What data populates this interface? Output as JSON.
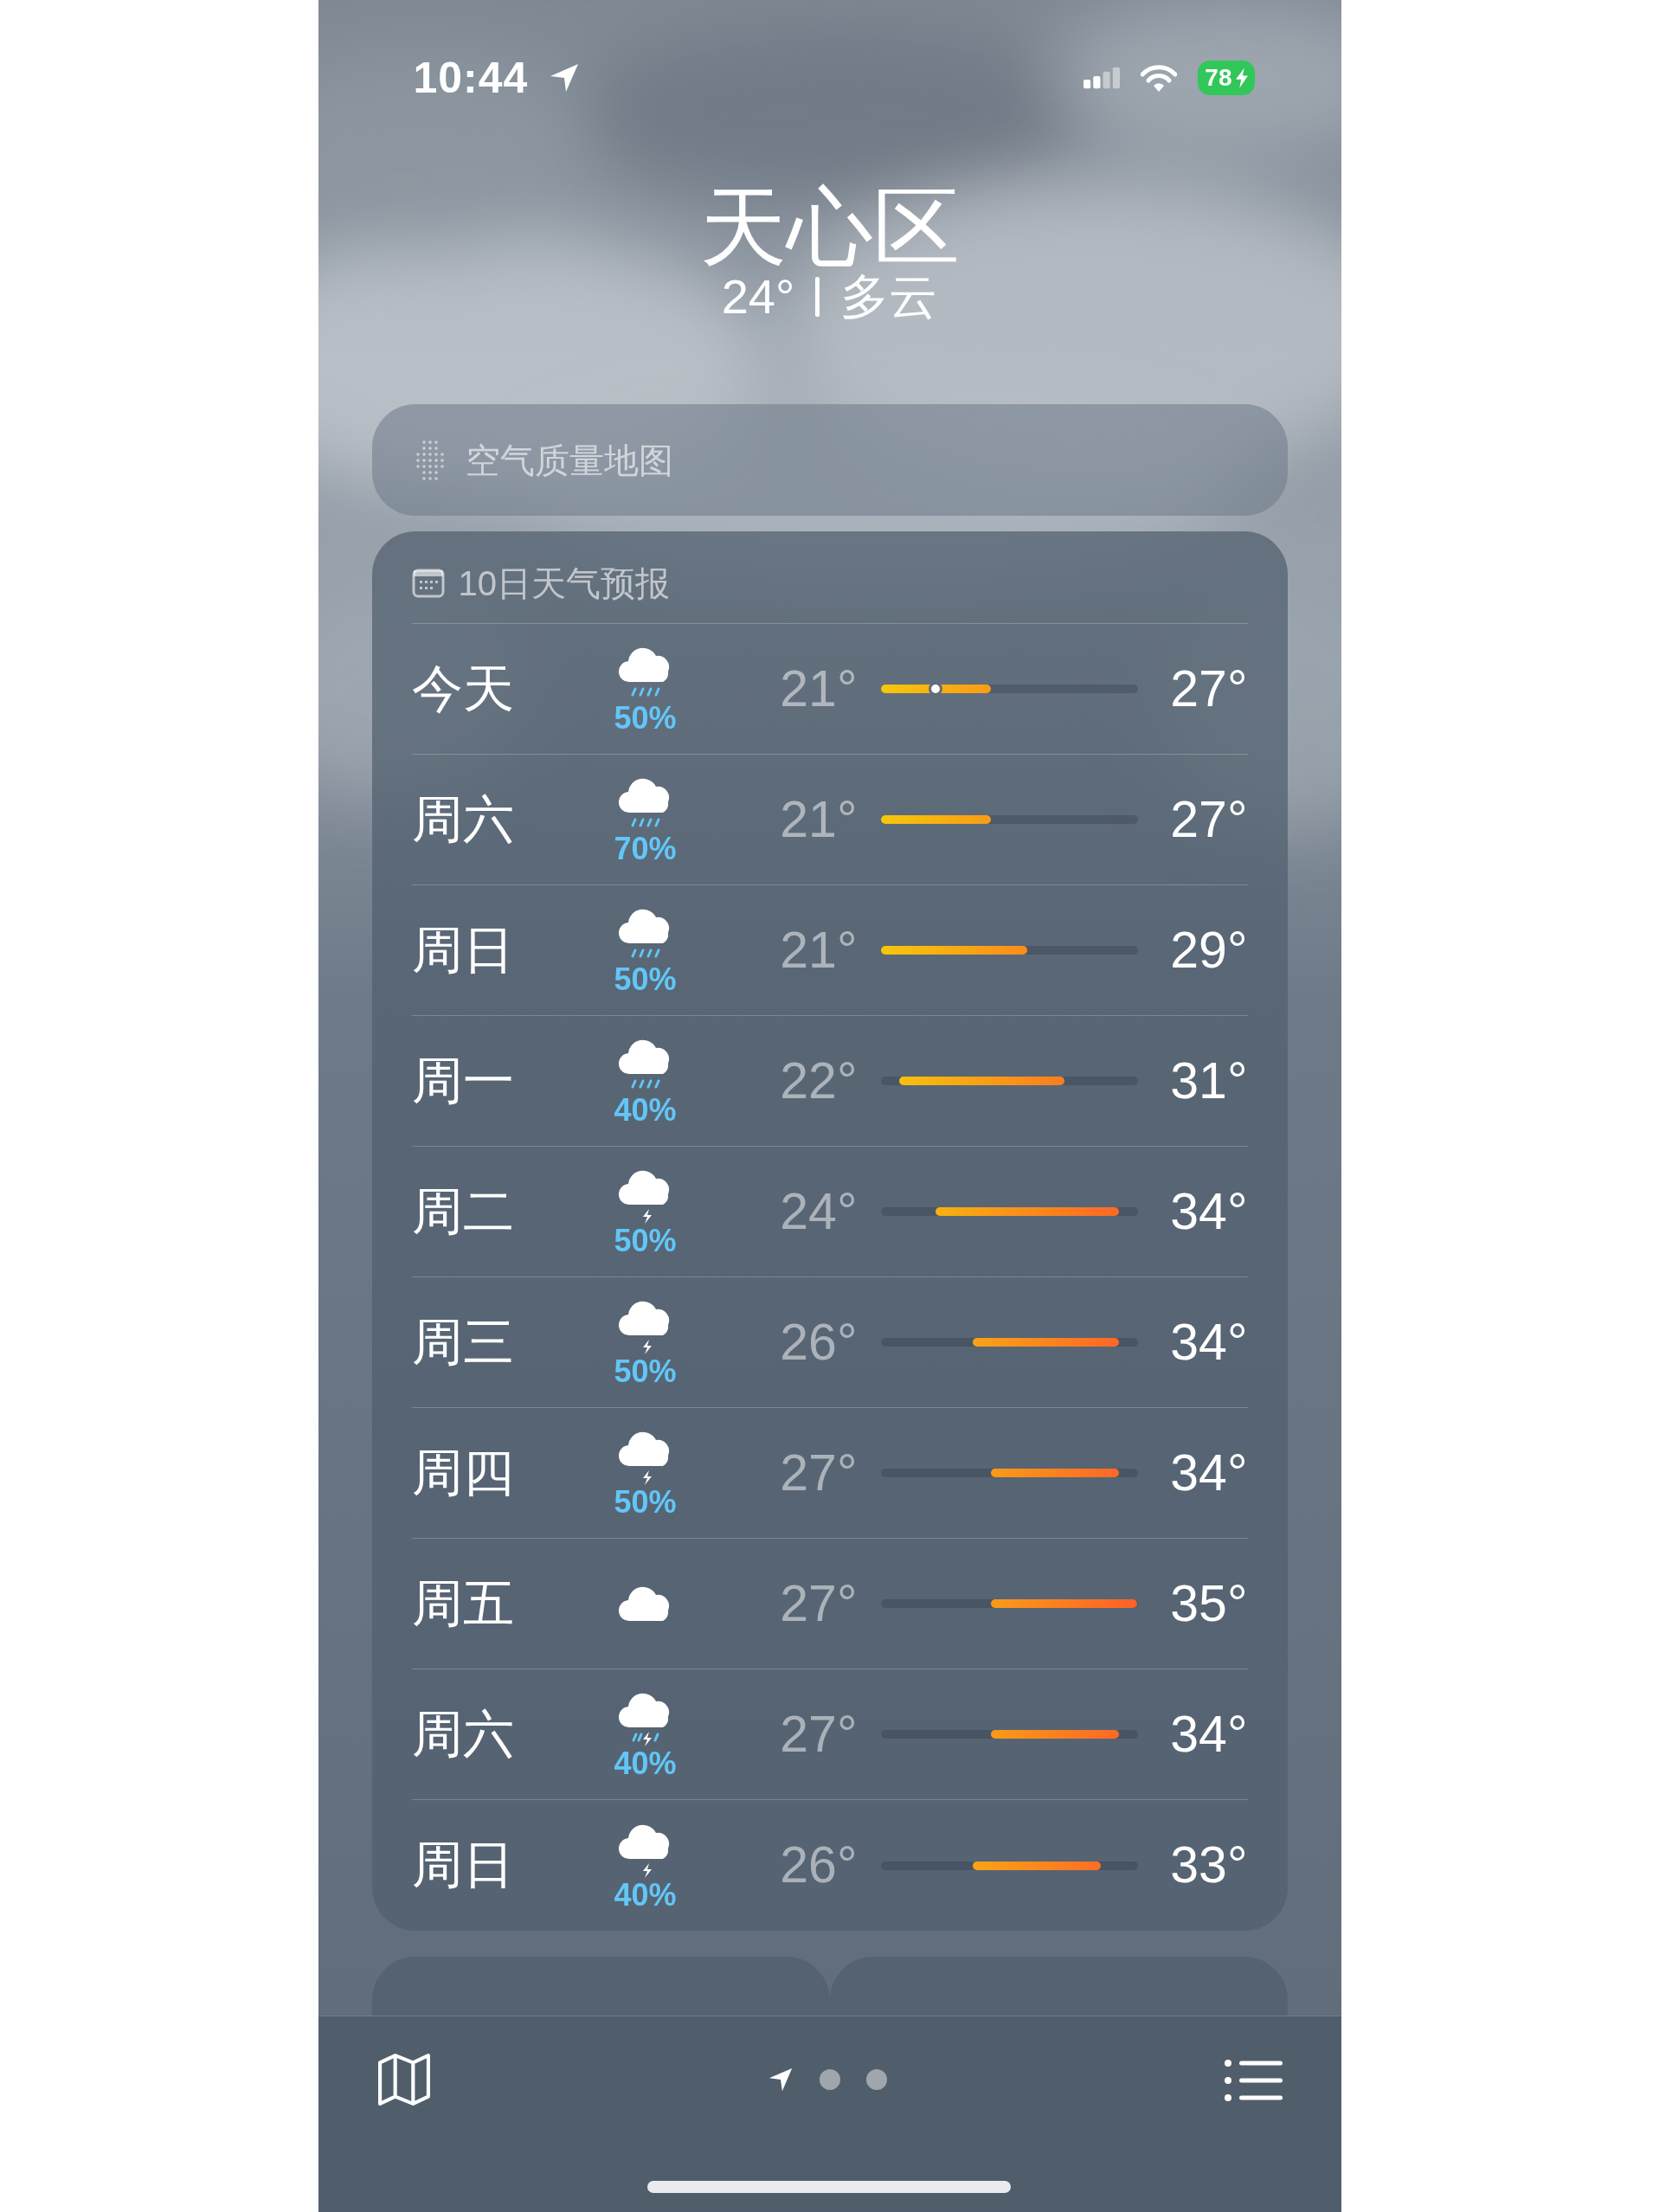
{
  "status_bar": {
    "time": "10:44",
    "battery": "78"
  },
  "location": {
    "name": "天心区",
    "temperature": "24°",
    "condition": "多云"
  },
  "air_quality": {
    "label": "空气质量地图"
  },
  "forecast": {
    "title": "10日天气预报",
    "days": [
      {
        "day": "今天",
        "kind": "rain",
        "precip": "50%",
        "low": "21°",
        "high": "27°",
        "now": true
      },
      {
        "day": "周六",
        "kind": "rain",
        "precip": "70%",
        "low": "21°",
        "high": "27°",
        "now": false
      },
      {
        "day": "周日",
        "kind": "rain",
        "precip": "50%",
        "low": "21°",
        "high": "29°",
        "now": false
      },
      {
        "day": "周一",
        "kind": "rain",
        "precip": "40%",
        "low": "22°",
        "high": "31°",
        "now": false
      },
      {
        "day": "周二",
        "kind": "thunder",
        "precip": "50%",
        "low": "24°",
        "high": "34°",
        "now": false
      },
      {
        "day": "周三",
        "kind": "thunder",
        "precip": "50%",
        "low": "26°",
        "high": "34°",
        "now": false
      },
      {
        "day": "周四",
        "kind": "thunder",
        "precip": "50%",
        "low": "27°",
        "high": "34°",
        "now": false
      },
      {
        "day": "周五",
        "kind": "cloud",
        "low": "27°",
        "high": "35°",
        "now": false
      },
      {
        "day": "周六",
        "kind": "storm",
        "precip": "40%",
        "low": "27°",
        "high": "34°",
        "now": false
      },
      {
        "day": "周日",
        "kind": "thunder",
        "precip": "40%",
        "low": "26°",
        "high": "33°",
        "now": false
      }
    ]
  },
  "tiles": [
    {
      "kind": "card"
    },
    {
      "kind": "card"
    }
  ],
  "toolbar": {
    "pages": [
      {
        "kind": "location",
        "selected": true
      },
      {
        "kind": "dot",
        "selected": false
      },
      {
        "kind": "dot",
        "selected": false
      }
    ]
  }
}
